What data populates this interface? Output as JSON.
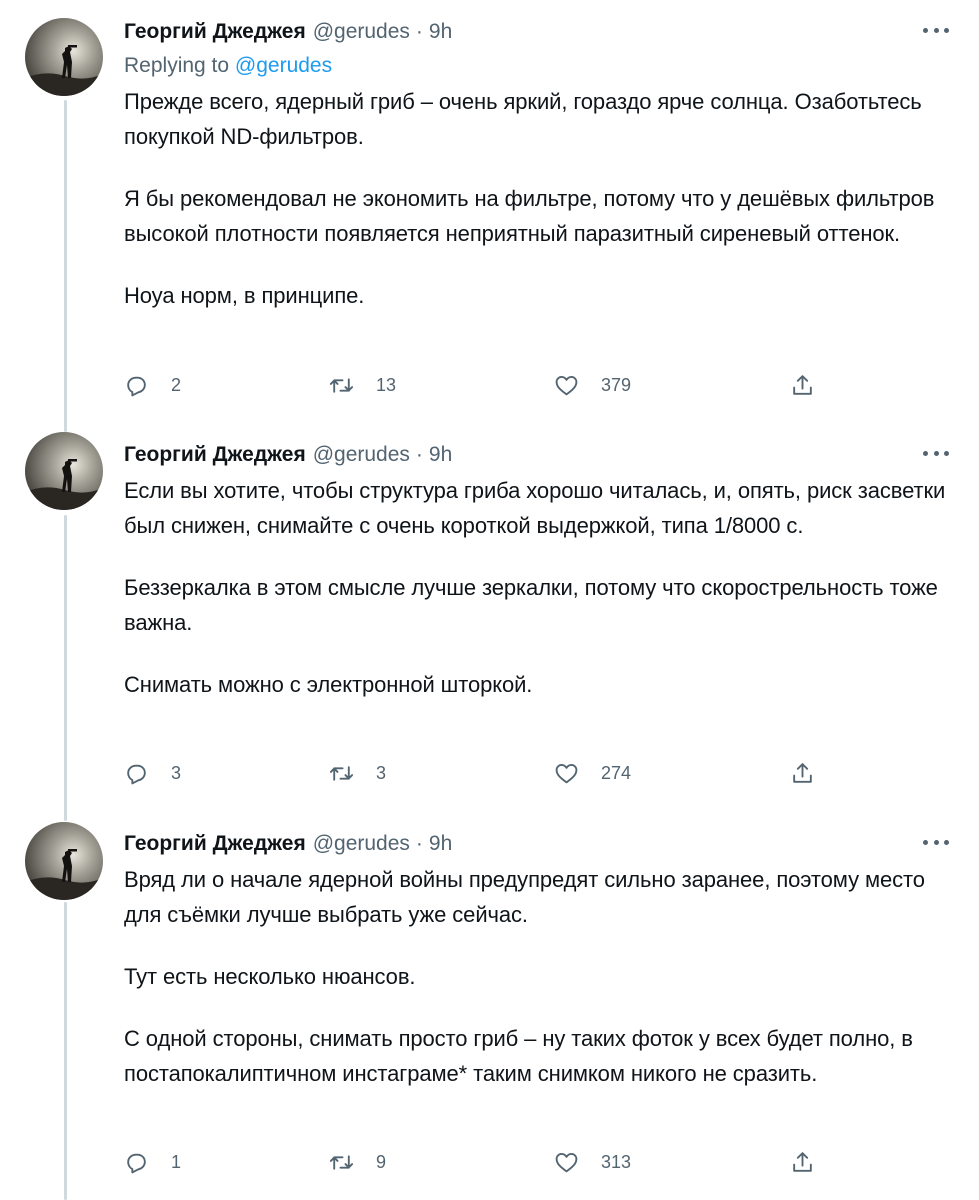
{
  "tweets": [
    {
      "author": "Георгий Джеджея",
      "handle": "@gerudes",
      "separator": "·",
      "time": "9h",
      "replying_prefix": "Replying to",
      "replying_to": "@gerudes",
      "paragraphs": [
        "Прежде всего, ядерный гриб – очень яркий, гораздо ярче солнца. Озаботьтесь покупкой ND-фильтров.",
        "Я бы рекомендовал не экономить на фильтре, потому что у дешёвых фильтров высокой плотности появляется неприятный паразитный сиреневый оттенок.",
        "Ноуа норм, в принципе."
      ],
      "replies": "2",
      "retweets": "13",
      "likes": "379"
    },
    {
      "author": "Георгий Джеджея",
      "handle": "@gerudes",
      "separator": "·",
      "time": "9h",
      "paragraphs": [
        "Если вы хотите, чтобы структура гриба хорошо читалась, и, опять, риск засветки был снижен, снимайте с очень короткой выдержкой, типа 1/8000 с.",
        "Беззеркалка в этом смысле лучше зеркалки, потому что скорострельность тоже важна.",
        "Снимать можно с электронной шторкой."
      ],
      "replies": "3",
      "retweets": "3",
      "likes": "274"
    },
    {
      "author": "Георгий Джеджея",
      "handle": "@gerudes",
      "separator": "·",
      "time": "9h",
      "paragraphs": [
        "Вряд ли о начале ядерной войны предупредят сильно заранее, поэтому место для съёмки лучше выбрать уже сейчас.",
        "Тут есть несколько нюансов.",
        "С одной стороны, снимать просто гриб – ну таких фоток у всех будет полно, в постапокалиптичном инстаграме* таким снимком никого не сразить."
      ],
      "replies": "1",
      "retweets": "9",
      "likes": "313"
    }
  ],
  "colors": {
    "text": "#0f1419",
    "secondary": "#536471",
    "accent": "#1d9bf0",
    "thread_line": "#cfd9de"
  },
  "icons": [
    "reply-icon",
    "retweet-icon",
    "like-icon",
    "share-icon",
    "more-icon"
  ]
}
